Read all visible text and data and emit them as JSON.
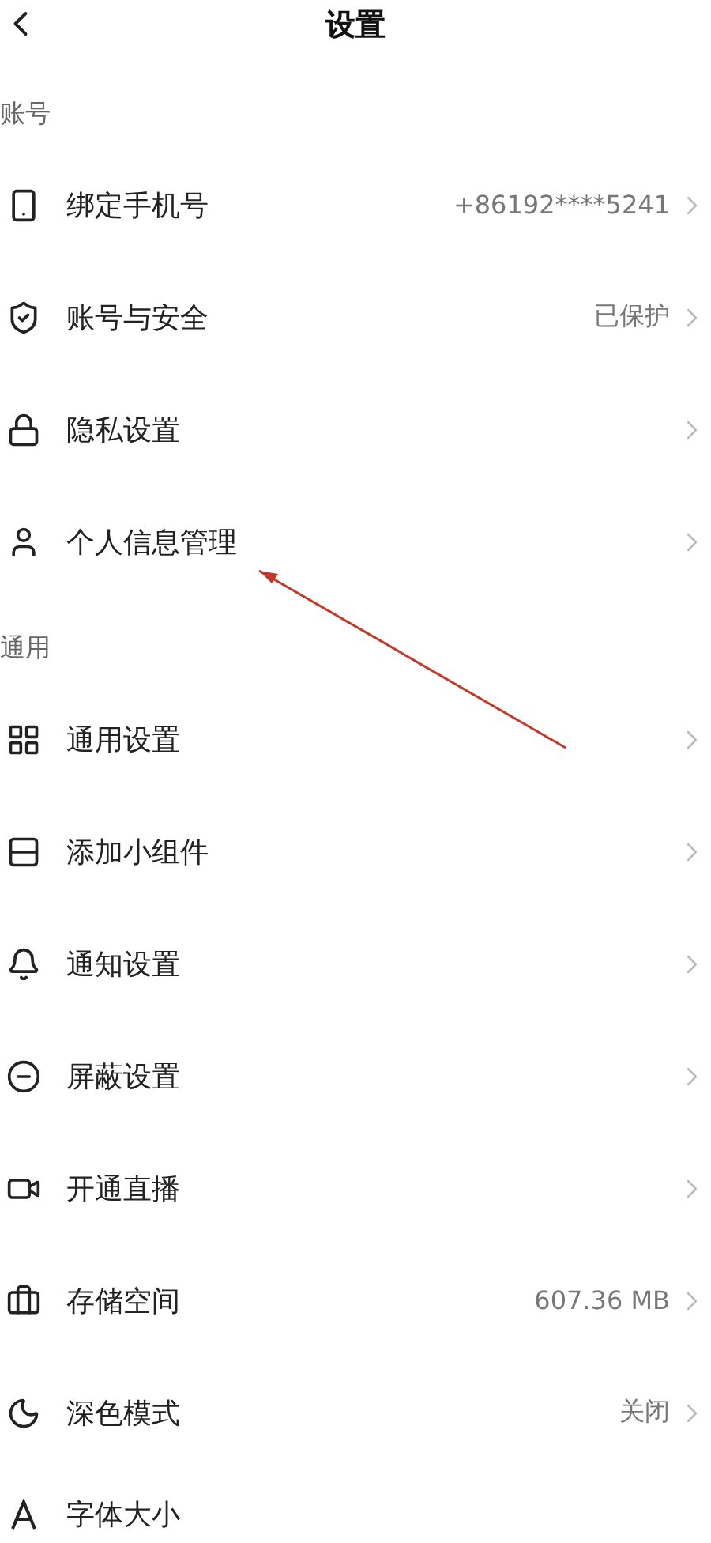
{
  "header": {
    "title": "设置"
  },
  "sections": [
    {
      "label": "账号",
      "items": [
        {
          "label": "绑定手机号",
          "value": "+86192****5241"
        },
        {
          "label": "账号与安全",
          "value": "已保护"
        },
        {
          "label": "隐私设置"
        },
        {
          "label": "个人信息管理"
        }
      ]
    },
    {
      "label": "通用",
      "items": [
        {
          "label": "通用设置"
        },
        {
          "label": "添加小组件"
        },
        {
          "label": "通知设置"
        },
        {
          "label": "屏蔽设置"
        },
        {
          "label": "开通直播"
        },
        {
          "label": "存储空间",
          "value": "607.36 MB"
        },
        {
          "label": "深色模式",
          "value": "关闭"
        },
        {
          "label": "字体大小"
        }
      ]
    }
  ]
}
